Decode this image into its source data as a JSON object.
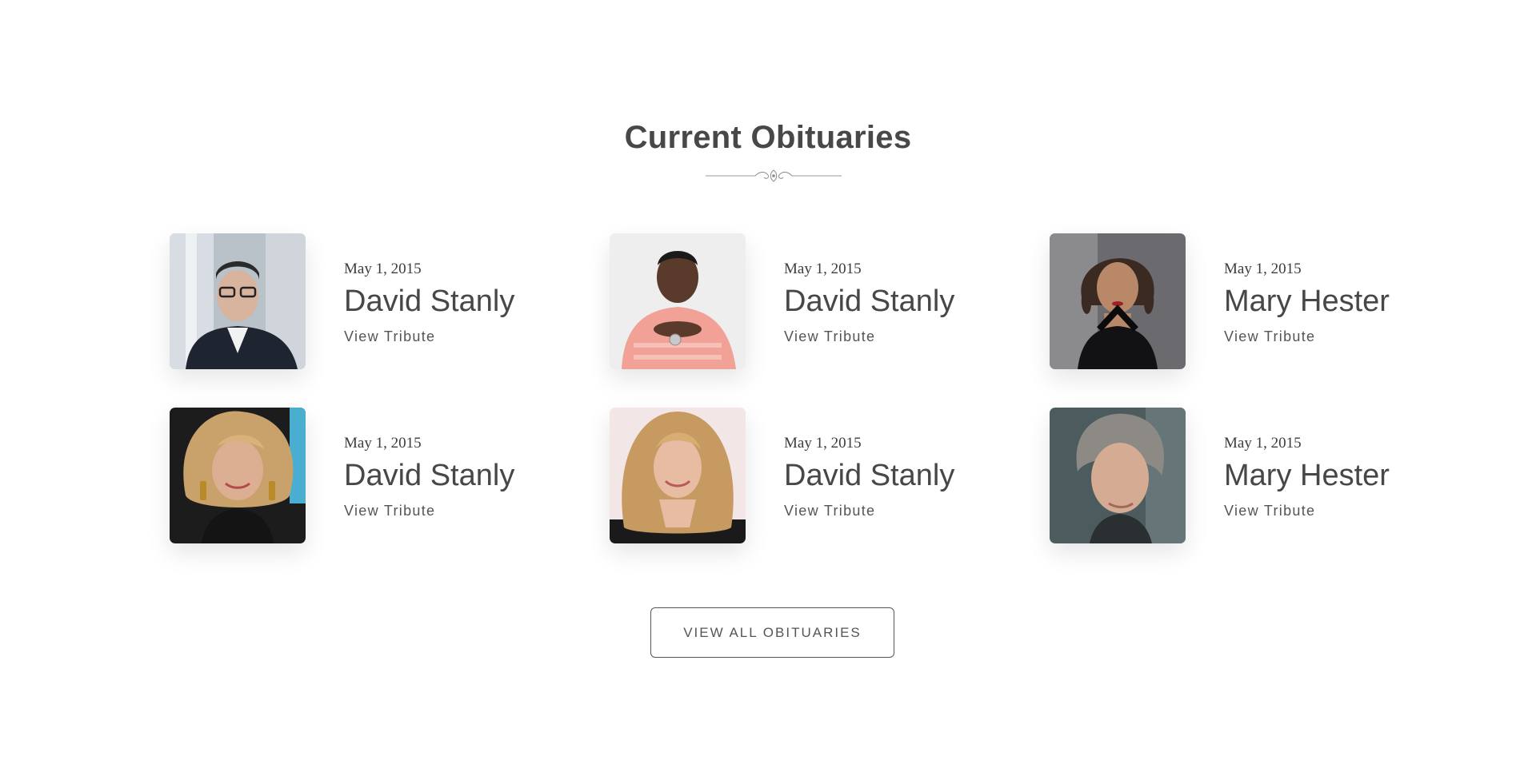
{
  "section": {
    "heading": "Current Obituaries",
    "view_all_label": "VIEW ALL OBITUARIES"
  },
  "obituaries": [
    {
      "date": "May 1, 2015",
      "name": "David Stanly",
      "link": "View Tribute",
      "photo_icon": "man-with-glasses-portrait"
    },
    {
      "date": "May 1, 2015",
      "name": "David Stanly",
      "link": "View Tribute",
      "photo_icon": "man-pink-shirt-portrait"
    },
    {
      "date": "May 1, 2015",
      "name": "Mary Hester",
      "link": "View Tribute",
      "photo_icon": "woman-dark-hair-portrait"
    },
    {
      "date": "May 1, 2015",
      "name": "David Stanly",
      "link": "View Tribute",
      "photo_icon": "woman-blonde-earrings-portrait"
    },
    {
      "date": "May 1, 2015",
      "name": "David Stanly",
      "link": "View Tribute",
      "photo_icon": "woman-blonde-smiling-portrait"
    },
    {
      "date": "May 1, 2015",
      "name": "Mary Hester",
      "link": "View Tribute",
      "photo_icon": "woman-short-gray-hair-portrait"
    }
  ],
  "colors": {
    "text": "#444444",
    "border": "#555555",
    "background": "#ffffff"
  }
}
